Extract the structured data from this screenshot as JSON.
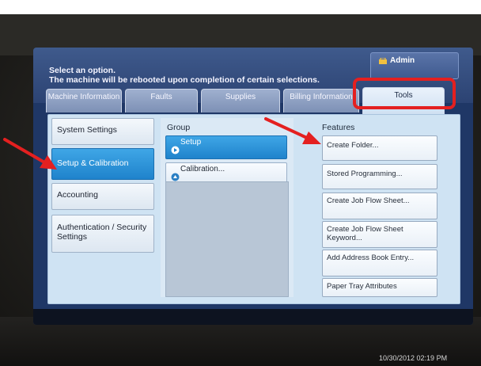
{
  "header": {
    "message_line1": "Select an option.",
    "message_line2": "The machine will be rebooted upon completion of certain selections.",
    "admin_label": "Admin"
  },
  "tabs": [
    {
      "label": "Machine Information",
      "active": false
    },
    {
      "label": "Faults",
      "active": false
    },
    {
      "label": "Supplies",
      "active": false
    },
    {
      "label": "Billing Information",
      "active": false
    },
    {
      "label": "Tools",
      "active": true
    }
  ],
  "left_menu": [
    {
      "label": "System Settings",
      "selected": false
    },
    {
      "label": "Setup & Calibration",
      "selected": true
    },
    {
      "label": "Accounting",
      "selected": false
    },
    {
      "label": "Authentication / Security Settings",
      "selected": false
    }
  ],
  "group": {
    "heading": "Group",
    "items": [
      {
        "label": "Setup",
        "selected": true,
        "icon": "arrow-right-circle-icon"
      },
      {
        "label": "Calibration...",
        "selected": false,
        "icon": "arrow-up-circle-icon"
      }
    ]
  },
  "features": {
    "heading": "Features",
    "items": [
      "Create Folder...",
      "Stored Programming...",
      "Create Job Flow Sheet...",
      "Create Job Flow Sheet Keyword...",
      "Add Address Book Entry...",
      "Paper Tray Attributes"
    ]
  },
  "status_bar": {
    "timestamp": "10/30/2012 02:19 PM"
  },
  "colors": {
    "selected_blue": "#2a93d8",
    "annotation_red": "#e42020",
    "screen_navy": "#1f3766"
  }
}
